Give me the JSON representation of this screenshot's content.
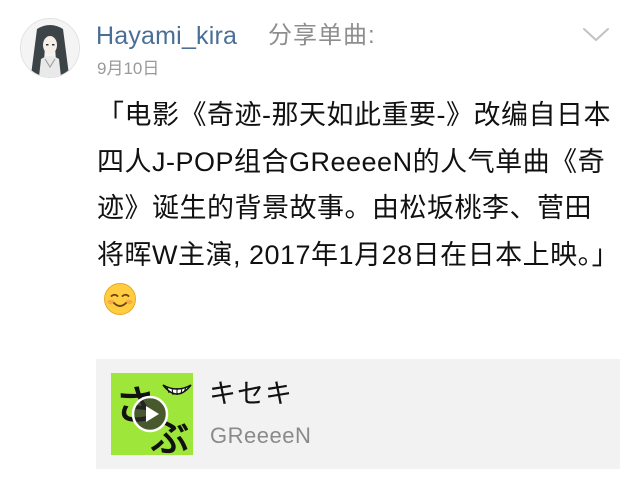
{
  "post": {
    "username": "Hayami_kira",
    "action": "分享单曲:",
    "date": "9月10日",
    "text": "「电影《奇迹-那天如此重要-》改编自日本四人J-POP组合GReeeeN的人气单曲《奇迹》诞生的背景故事。由松坂桃李、菅田将晖W主演, 2017年1月28日在日本上映。」",
    "emoji": "smiling-face-icon"
  },
  "music_card": {
    "title": "キセキ",
    "artist": "GReeeeN",
    "cover_color": "#9ee63a",
    "cover_logo_text": "さぶ"
  },
  "colors": {
    "username": "#4a6f97",
    "secondary": "#8e8e8e",
    "card_background": "#f2f2f2"
  }
}
